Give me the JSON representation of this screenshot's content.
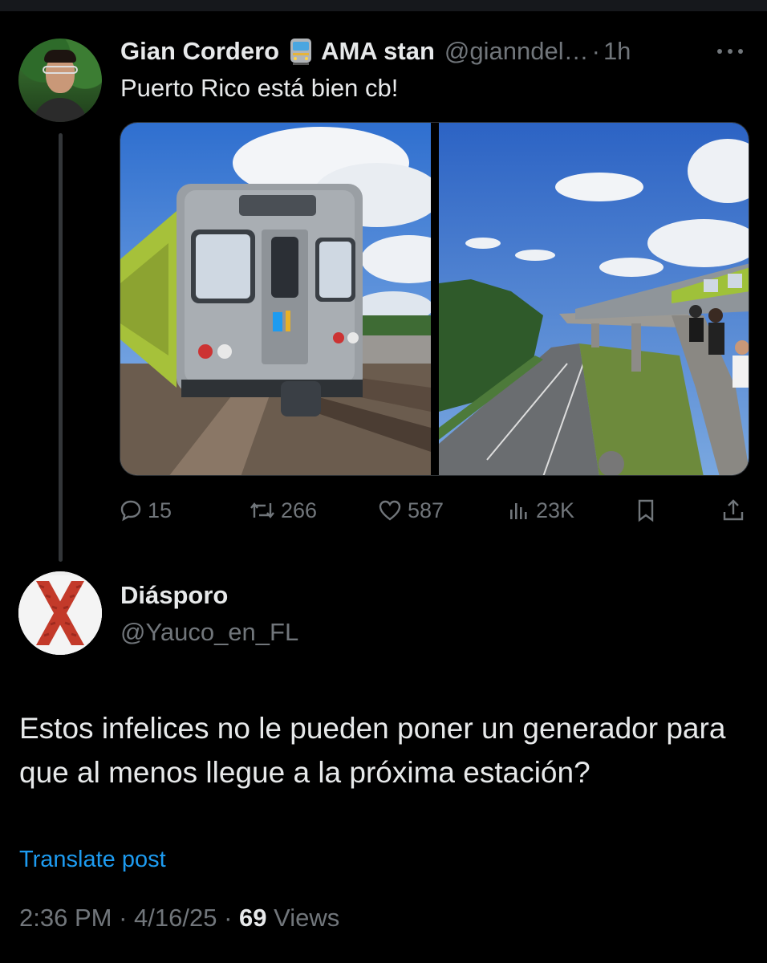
{
  "parent_tweet": {
    "author_name": "Gian Cordero",
    "author_suffix": "AMA stan",
    "handle": "@gianndel…",
    "separator": "·",
    "time": "1h",
    "text": "Puerto Rico está bien cb!",
    "stats": {
      "replies": "15",
      "reposts": "266",
      "likes": "587",
      "views": "23K"
    }
  },
  "reply_tweet": {
    "author_name": "Diásporo",
    "handle": "@Yauco_en_FL",
    "text": "Estos infelices no le pueden poner un generador para que al menos llegue a la próxima estación?",
    "translate_label": "Translate post",
    "time": "2:36 PM",
    "date": "4/16/25",
    "separator": "·",
    "views_count": "69",
    "views_label": "Views"
  },
  "icons": {
    "author_emoji": "tram-emoji-icon",
    "more": "more-options-icon",
    "reply": "reply-icon",
    "repost": "repost-icon",
    "like": "heart-icon",
    "views": "bar-chart-icon",
    "bookmark": "bookmark-icon",
    "share": "share-icon"
  },
  "colors": {
    "background": "#000000",
    "text_primary": "#e7e9ea",
    "text_secondary": "#71767b",
    "link": "#1d9bf0"
  }
}
